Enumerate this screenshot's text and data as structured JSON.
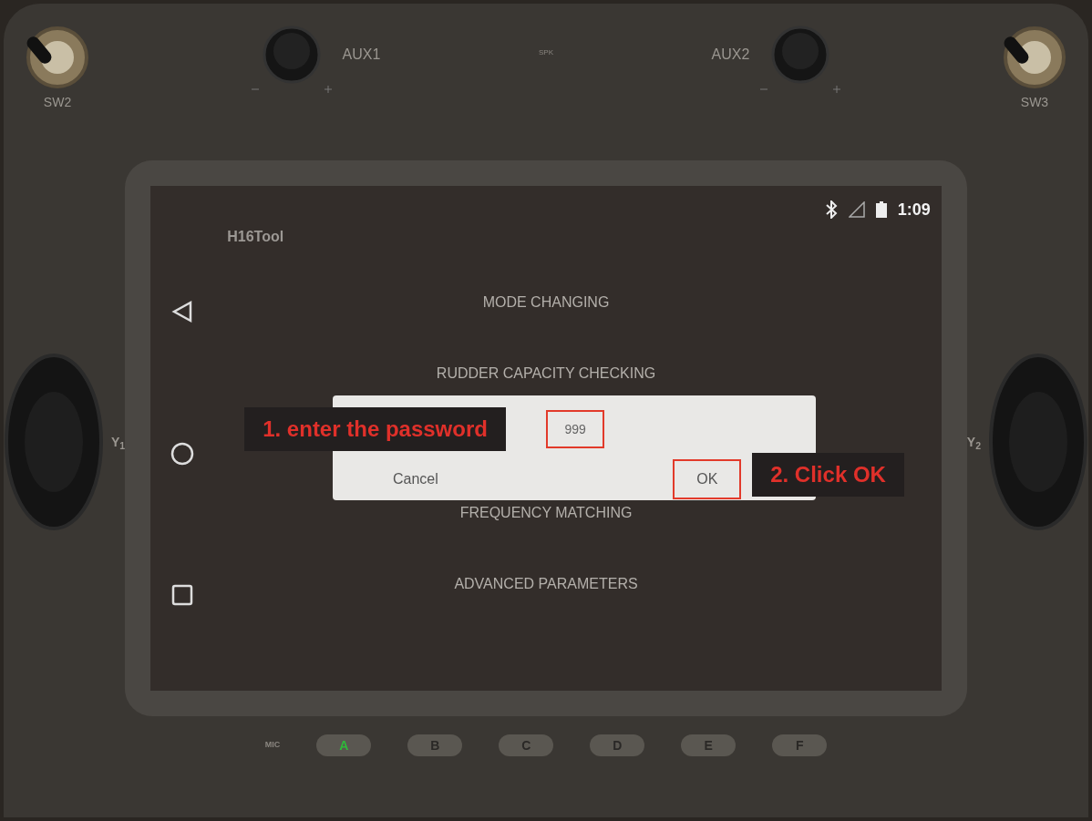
{
  "controller": {
    "top_left_switch": "SW2",
    "knob_left": "AUX1",
    "speaker": "SPK",
    "knob_right": "AUX2",
    "top_right_switch": "SW3",
    "left_stick_label": "Y$_{1}$",
    "right_stick_label": "Y$_{2}$",
    "mic": "MIC",
    "buttons": [
      {
        "label": "A",
        "lit": true
      },
      {
        "label": "B",
        "lit": false
      },
      {
        "label": "C",
        "lit": false
      },
      {
        "label": "D",
        "lit": false
      },
      {
        "label": "E",
        "lit": false
      },
      {
        "label": "F",
        "lit": false
      }
    ]
  },
  "screen": {
    "status_bar": {
      "time": "1:09"
    },
    "app_title": "H16Tool",
    "menu_items": [
      "MODE CHANGING",
      "RUDDER CAPACITY CHECKING",
      "FREQUENCY MATCHING",
      "ADVANCED PARAMETERS"
    ],
    "dialog": {
      "password": "999",
      "buttons": [
        "Cancel",
        "OK"
      ]
    }
  },
  "annotations": [
    {
      "text": "1. enter the password"
    },
    {
      "text": "2. Click OK"
    }
  ]
}
